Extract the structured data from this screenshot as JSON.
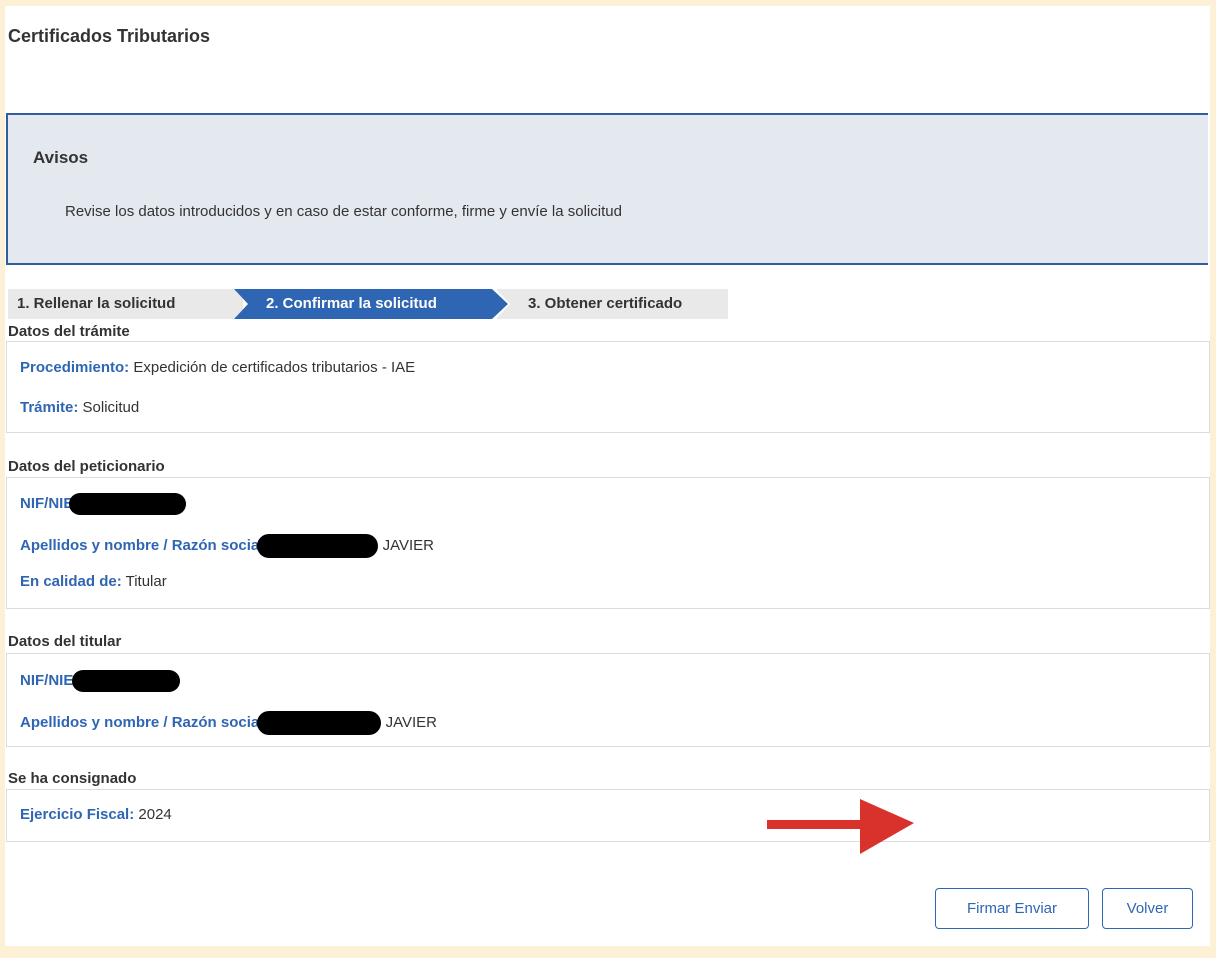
{
  "page": {
    "title": "Certificados Tributarios"
  },
  "notice": {
    "title": "Avisos",
    "text": "Revise los datos introducidos y en caso de estar conforme, firme y envíe la solicitud"
  },
  "steps": [
    {
      "label": "1. Rellenar la solicitud",
      "state": "done"
    },
    {
      "label": "2. Confirmar la solicitud",
      "state": "active"
    },
    {
      "label": "3. Obtener certificado",
      "state": "pending"
    }
  ],
  "tramite": {
    "heading": "Datos del trámite",
    "procedimiento_label": "Procedimiento:",
    "procedimiento_value": "Expedición de certificados tributarios - IAE",
    "tramite_label": "Trámite:",
    "tramite_value": "Solicitud"
  },
  "peticionario": {
    "heading": "Datos del peticionario",
    "nif_label": "NIF/NIE",
    "nombre_label": "Apellidos y nombre / Razón social",
    "nombre_visible": "JAVIER",
    "calidad_label": "En calidad de:",
    "calidad_value": "Titular"
  },
  "titular": {
    "heading": "Datos del titular",
    "nif_label": "NIF/NIE:",
    "nombre_label": "Apellidos y nombre / Razón social",
    "nombre_visible": "JAVIER"
  },
  "consignado": {
    "heading": "Se ha consignado",
    "ejercicio_label": "Ejercicio Fiscal:",
    "ejercicio_value": "2024"
  },
  "actions": {
    "sign_send": "Firmar Enviar",
    "back": "Volver"
  },
  "colors": {
    "accent": "#2f66b3",
    "notice_bg": "#e4e9f0",
    "annotation_arrow": "#d9312b",
    "page_bg": "#fcf1d6"
  }
}
